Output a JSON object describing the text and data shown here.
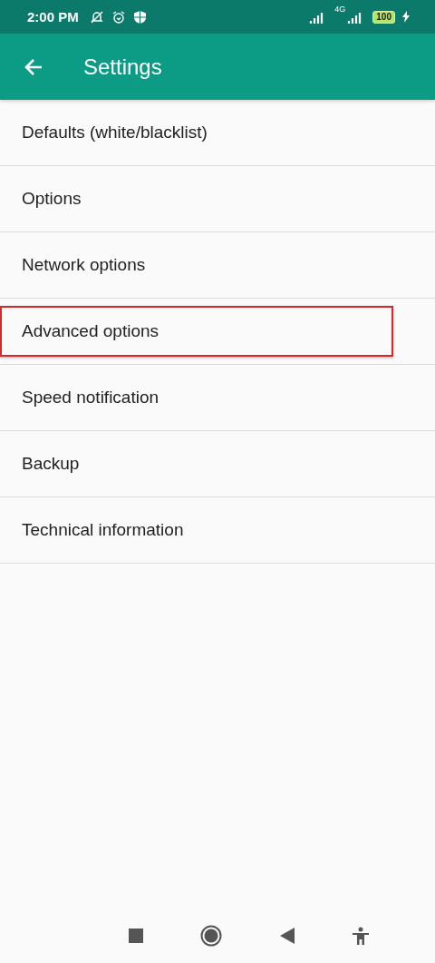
{
  "status_bar": {
    "time": "2:00 PM",
    "network": "4G",
    "battery": "100"
  },
  "app_bar": {
    "title": "Settings"
  },
  "items": [
    {
      "label": "Defaults (white/blacklist)",
      "highlighted": false
    },
    {
      "label": "Options",
      "highlighted": false
    },
    {
      "label": "Network options",
      "highlighted": false
    },
    {
      "label": "Advanced options",
      "highlighted": true
    },
    {
      "label": "Speed notification",
      "highlighted": false
    },
    {
      "label": "Backup",
      "highlighted": false
    },
    {
      "label": "Technical information",
      "highlighted": false
    }
  ]
}
